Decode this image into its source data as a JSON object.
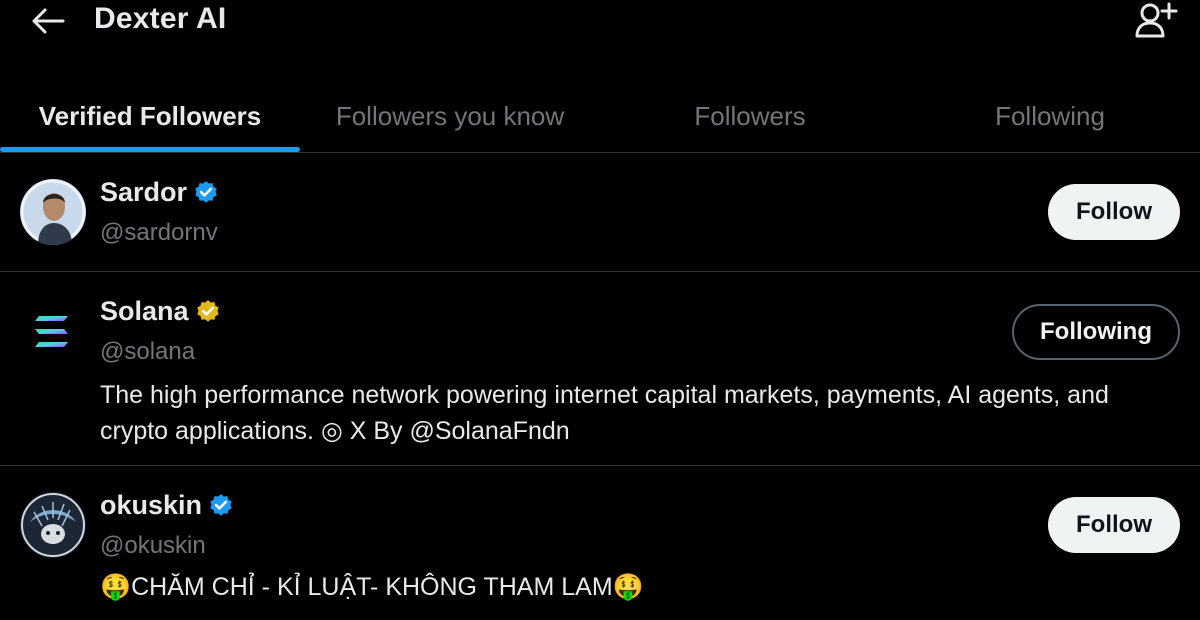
{
  "header": {
    "title": "Dexter AI"
  },
  "tabs": [
    {
      "label": "Verified Followers",
      "active": true
    },
    {
      "label": "Followers you know",
      "active": false
    },
    {
      "label": "Followers",
      "active": false
    },
    {
      "label": "Following",
      "active": false
    }
  ],
  "accounts": [
    {
      "name": "Sardor",
      "handle": "@sardornv",
      "badge": "blue",
      "bio": "",
      "button_label": "Follow"
    },
    {
      "name": "Solana",
      "handle": "@solana",
      "badge": "gold",
      "bio": "The high performance network powering internet capital markets, payments, AI agents, and crypto applications. ◎ X By @SolanaFndn",
      "button_label": "Following"
    },
    {
      "name": "okuskin",
      "handle": "@okuskin",
      "badge": "blue",
      "bio": "🤑CHĂM CHỈ - KỈ LUẬT- KHÔNG THAM LAM🤑",
      "button_label": "Follow"
    }
  ],
  "colors": {
    "background": "#000000",
    "accent": "#1d9bf0",
    "verified_blue": "#1d9bf0",
    "verified_gold": "#e2b719",
    "muted_text": "#71767b"
  },
  "icons": {
    "back": "arrow-left-icon",
    "add_user": "add-user-icon",
    "verified_blue": "verified-badge-icon",
    "verified_gold": "gold-verified-badge-icon"
  }
}
